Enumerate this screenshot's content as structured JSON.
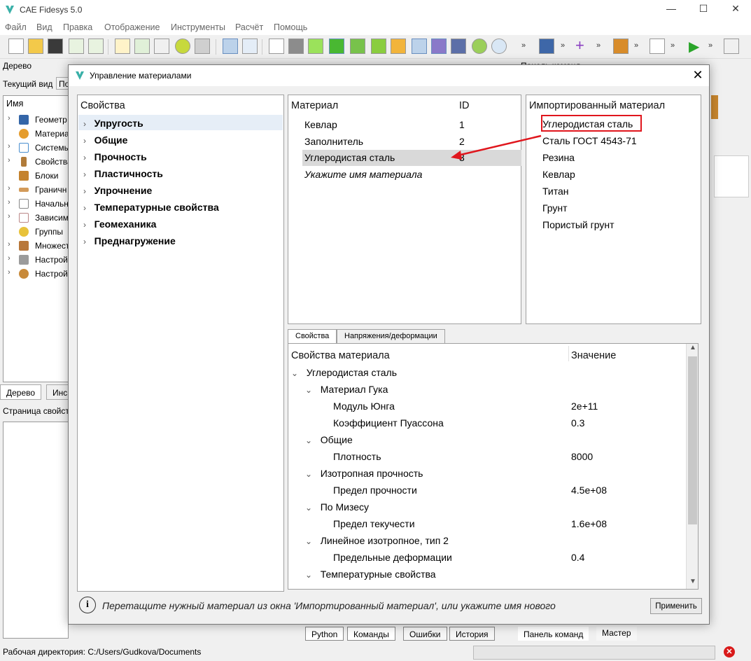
{
  "app": {
    "title": "CAE Fidesys 5.0"
  },
  "menu": [
    "Файл",
    "Вид",
    "Правка",
    "Отображение",
    "Инструменты",
    "Расчёт",
    "Помощь"
  ],
  "left": {
    "dock_title": "Дерево",
    "current_view_label": "Текущий вид",
    "current_view_value": "По",
    "tree_header": "Имя",
    "tree_items": [
      "Геометр",
      "Материа",
      "Системы",
      "Свойства",
      "Блоки",
      "Граничн",
      "Начальн",
      "Зависим",
      "Группы",
      "Множест",
      "Настрой",
      "Настрой"
    ],
    "tabs": [
      "Дерево",
      "Инс"
    ],
    "props_title": "Страница свойств"
  },
  "right": {
    "dock_title": "Панель команд"
  },
  "bottom_tabs": [
    "Python",
    "Команды",
    "Ошибки",
    "История"
  ],
  "right_tabs": [
    "Панель команд",
    "Мастер"
  ],
  "status": {
    "workdir": "Рабочая директория: C:/Users/Gudkova/Documents"
  },
  "dialog": {
    "title": "Управление материалами",
    "properties": {
      "header": "Свойства",
      "items": [
        "Упругость",
        "Общие",
        "Прочность",
        "Пластичность",
        "Упрочнение",
        "Температурные свойства",
        "Геомеханика",
        "Преднагружение"
      ]
    },
    "materials": {
      "header_name": "Материал",
      "header_id": "ID",
      "rows": [
        {
          "name": "Кевлар",
          "id": "1"
        },
        {
          "name": "Заполнитель",
          "id": "2"
        },
        {
          "name": "Углеродистая сталь",
          "id": "3"
        }
      ],
      "placeholder": "Укажите имя материала"
    },
    "imported": {
      "header": "Импортированный материал",
      "items": [
        "Углеродистая сталь",
        "Сталь ГОСТ 4543-71",
        "Резина",
        "Кевлар",
        "Титан",
        "Грунт",
        "Пористый грунт"
      ]
    },
    "tabs": [
      "Свойства",
      "Напряжения/деформации"
    ],
    "material_props": {
      "header_name": "Свойства материала",
      "header_value": "Значение",
      "rows": [
        {
          "level": 0,
          "expand": true,
          "name": "Углеродистая сталь",
          "value": ""
        },
        {
          "level": 1,
          "expand": true,
          "name": "Материал Гука",
          "value": ""
        },
        {
          "level": 2,
          "expand": false,
          "name": "Модуль Юнга",
          "value": "2e+11"
        },
        {
          "level": 2,
          "expand": false,
          "name": "Коэффициент Пуассона",
          "value": "0.3"
        },
        {
          "level": 1,
          "expand": true,
          "name": "Общие",
          "value": ""
        },
        {
          "level": 2,
          "expand": false,
          "name": "Плотность",
          "value": "8000"
        },
        {
          "level": 1,
          "expand": true,
          "name": "Изотропная прочность",
          "value": ""
        },
        {
          "level": 2,
          "expand": false,
          "name": "Предел прочности",
          "value": "4.5e+08"
        },
        {
          "level": 1,
          "expand": true,
          "name": "По Мизесу",
          "value": ""
        },
        {
          "level": 2,
          "expand": false,
          "name": "Предел текучести",
          "value": "1.6e+08"
        },
        {
          "level": 1,
          "expand": true,
          "name": "Линейное изотропное, тип 2",
          "value": ""
        },
        {
          "level": 2,
          "expand": false,
          "name": "Предельные деформации",
          "value": "0.4"
        },
        {
          "level": 1,
          "expand": true,
          "name": "Температурные свойства",
          "value": ""
        }
      ]
    },
    "hint": "Перетащите нужный материал из окна 'Импортированный материал', или укажите имя нового",
    "apply_label": "Применить"
  },
  "colors": {
    "highlight_red": "#e0161d",
    "selection": "#d9d9d9",
    "accent": "#3ab0a8"
  }
}
